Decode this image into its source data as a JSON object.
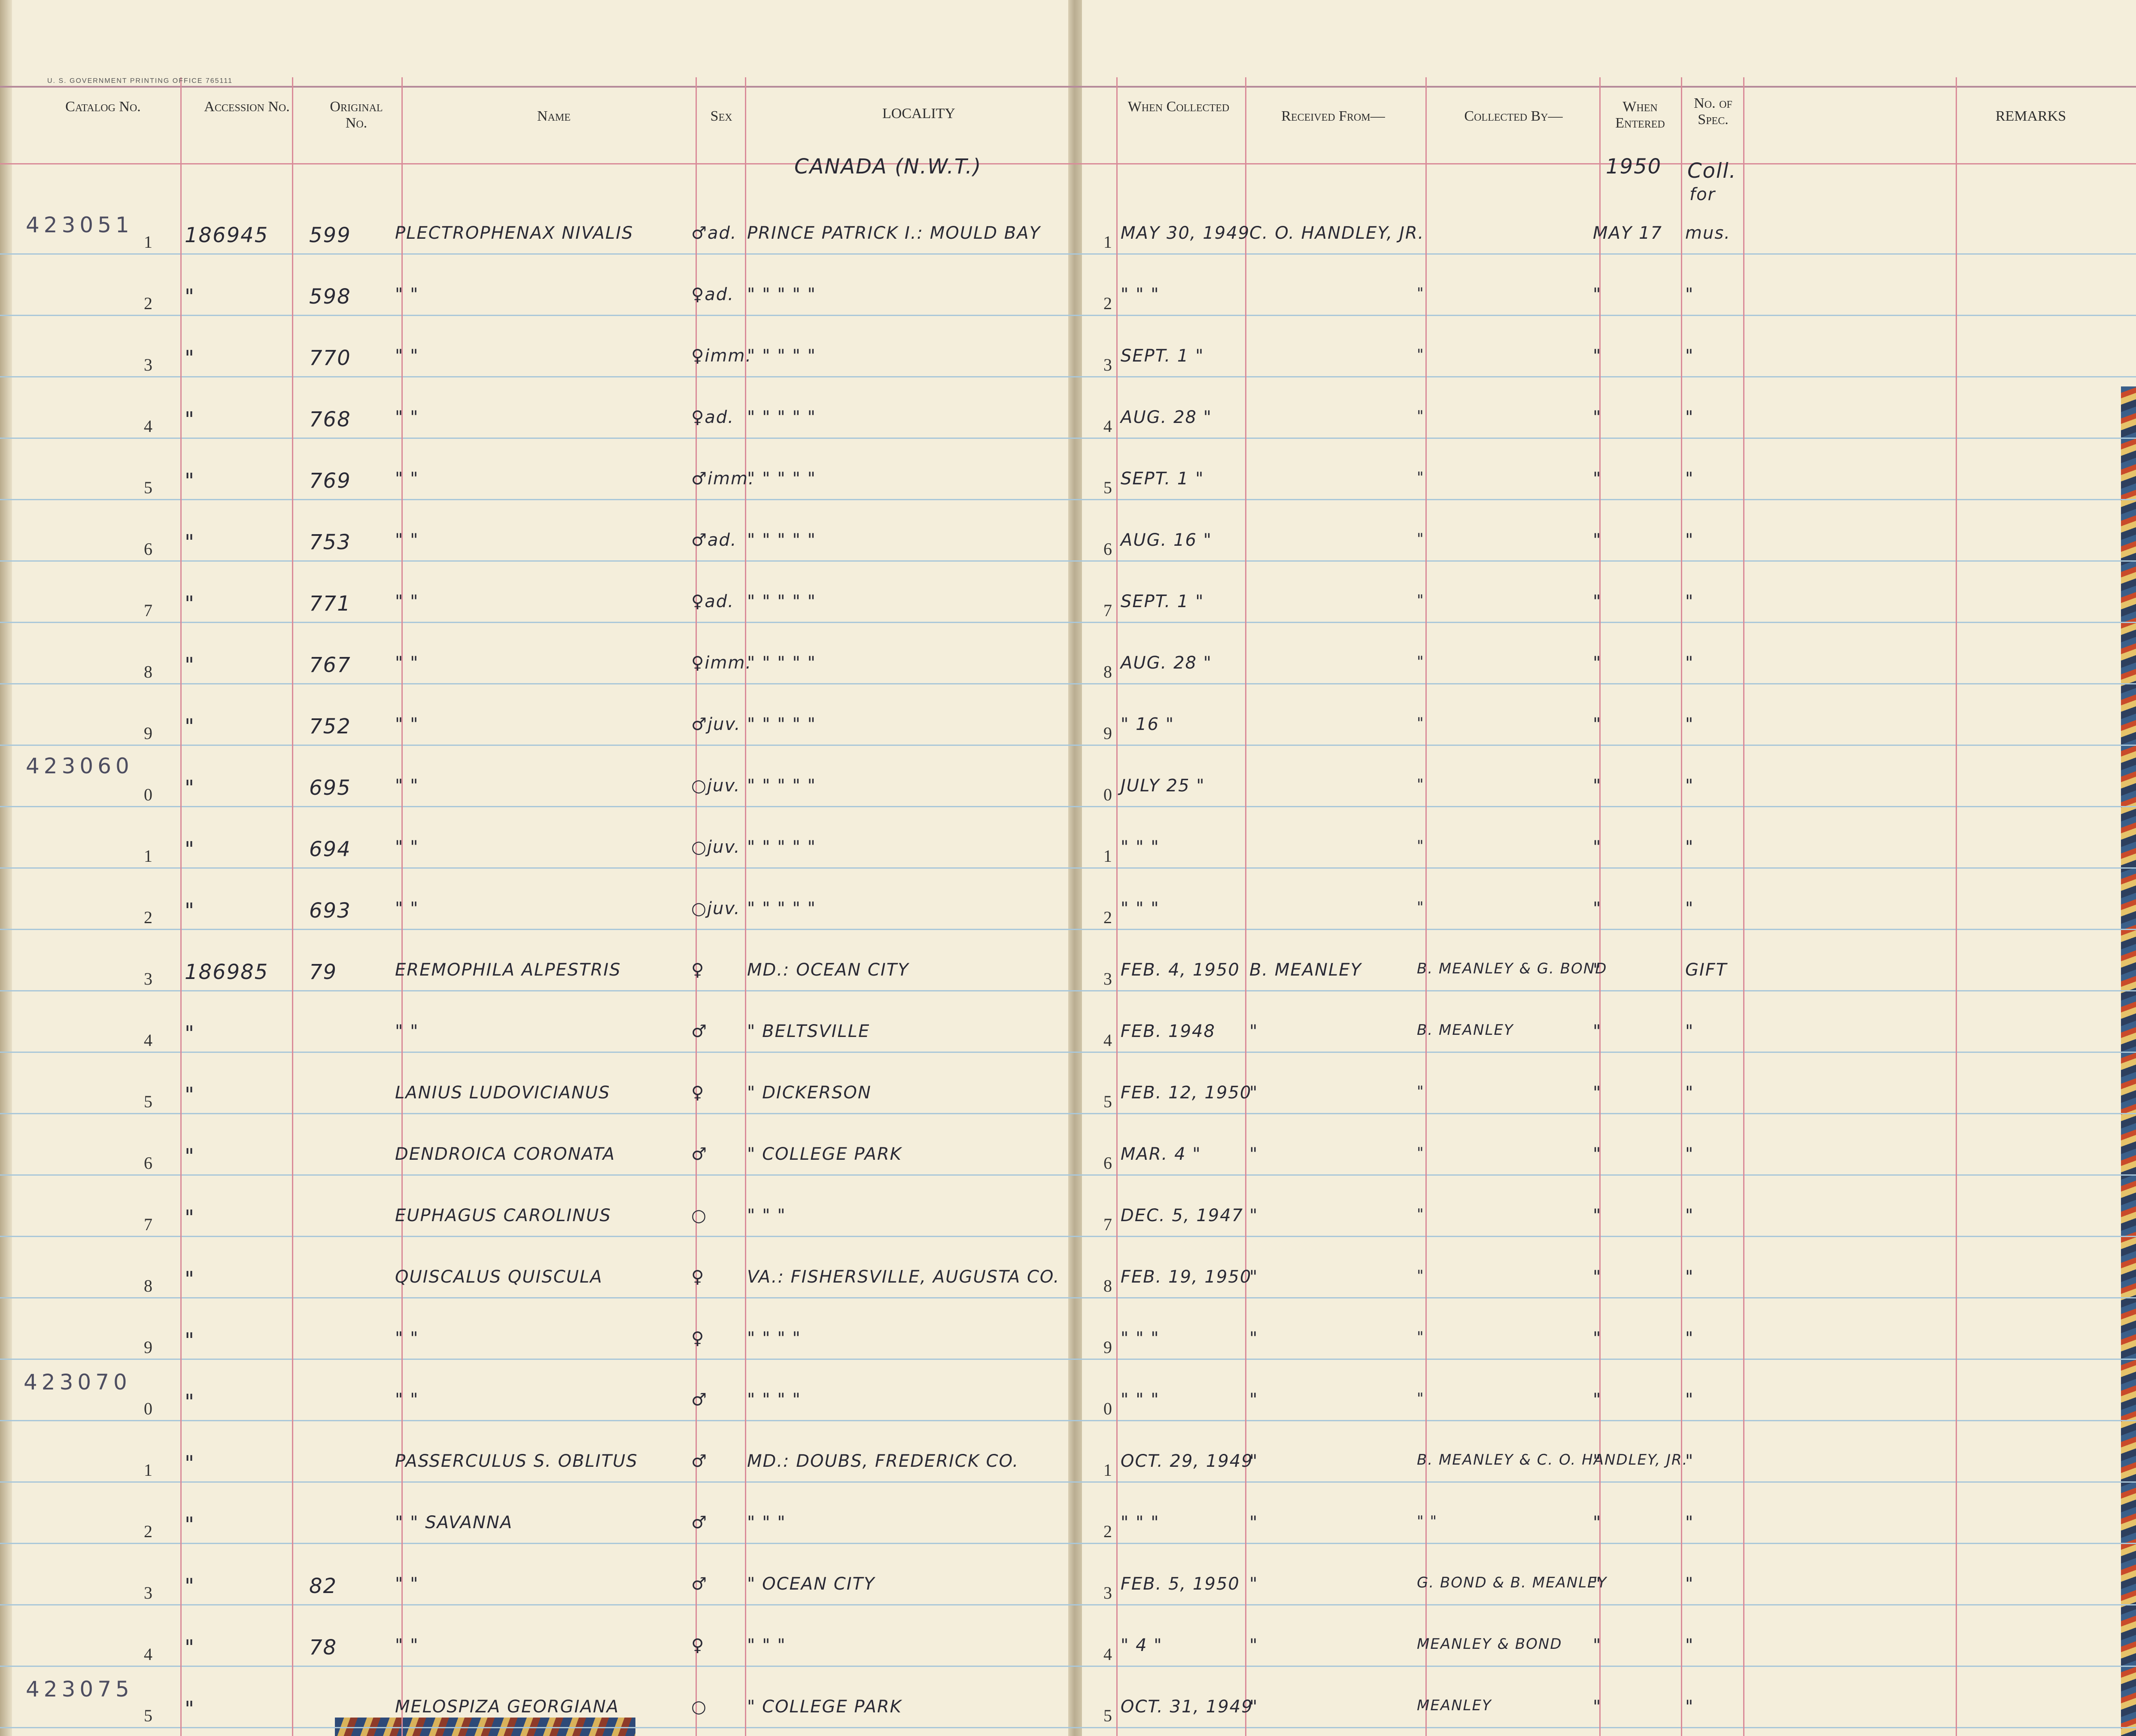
{
  "printer_line": "U. S. GOVERNMENT PRINTING OFFICE    765111",
  "headers": {
    "catalog": "Catalog No.",
    "accession": "Accession No.",
    "original": "Original No.",
    "name": "Name",
    "sex": "Sex",
    "locality": "LOCALITY",
    "when_collected": "When Collected",
    "received_from": "Received From—",
    "collected_by": "Collected By—",
    "when_entered": "When Entered",
    "no_of_spec": "No. of Spec.",
    "remarks": "REMARKS"
  },
  "top_notes": {
    "locality_heading": "CANADA (N.W.T.)",
    "year_entered": "1950",
    "spec_note_1": "Coll.",
    "spec_note_2": "for"
  },
  "catalog_prefixes": [
    "423051",
    "423060",
    "423070",
    "423075"
  ],
  "rows": [
    {
      "n": "1",
      "acc": "186945",
      "orig": "599",
      "name": "PLECTROPHENAX NIVALIS",
      "sex": "♂ad.",
      "loc": "PRINCE PATRICK I.: MOULD BAY",
      "date": "MAY 30, 1949",
      "recv": "C. O. HANDLEY, JR.",
      "coll": "",
      "entered": "MAY 17",
      "spec": "mus."
    },
    {
      "n": "2",
      "acc": "\"",
      "orig": "598",
      "name": "\"        \"",
      "sex": "♀ad.",
      "loc": "\"   \"   \"   \"   \"",
      "date": "\"   \"   \"",
      "recv": "",
      "coll": "\"",
      "entered": "\"",
      "spec": "\""
    },
    {
      "n": "3",
      "acc": "\"",
      "orig": "770",
      "name": "\"        \"",
      "sex": "♀imm.",
      "loc": "\"   \"   \"   \"   \"",
      "date": "SEPT. 1  \"",
      "recv": "",
      "coll": "\"",
      "entered": "\"",
      "spec": "\""
    },
    {
      "n": "4",
      "acc": "\"",
      "orig": "768",
      "name": "\"        \"",
      "sex": "♀ad.",
      "loc": "\"   \"   \"   \"   \"",
      "date": "AUG. 28  \"",
      "recv": "",
      "coll": "\"",
      "entered": "\"",
      "spec": "\""
    },
    {
      "n": "5",
      "acc": "\"",
      "orig": "769",
      "name": "\"        \"",
      "sex": "♂imm.",
      "loc": "\"   \"   \"   \"   \"",
      "date": "SEPT. 1  \"",
      "recv": "",
      "coll": "\"",
      "entered": "\"",
      "spec": "\""
    },
    {
      "n": "6",
      "acc": "\"",
      "orig": "753",
      "name": "\"        \"",
      "sex": "♂ad.",
      "loc": "\"   \"   \"   \"   \"",
      "date": "AUG. 16  \"",
      "recv": "",
      "coll": "\"",
      "entered": "\"",
      "spec": "\""
    },
    {
      "n": "7",
      "acc": "\"",
      "orig": "771",
      "name": "\"        \"",
      "sex": "♀ad.",
      "loc": "\"   \"   \"   \"   \"",
      "date": "SEPT. 1  \"",
      "recv": "",
      "coll": "\"",
      "entered": "\"",
      "spec": "\""
    },
    {
      "n": "8",
      "acc": "\"",
      "orig": "767",
      "name": "\"        \"",
      "sex": "♀imm.",
      "loc": "\"   \"   \"   \"   \"",
      "date": "AUG. 28  \"",
      "recv": "",
      "coll": "\"",
      "entered": "\"",
      "spec": "\""
    },
    {
      "n": "9",
      "acc": "\"",
      "orig": "752",
      "name": "\"        \"",
      "sex": "♂juv.",
      "loc": "\"   \"   \"   \"   \"",
      "date": "\"  16  \"",
      "recv": "",
      "coll": "\"",
      "entered": "\"",
      "spec": "\""
    },
    {
      "n": "0",
      "acc": "\"",
      "orig": "695",
      "name": "\"        \"",
      "sex": "○juv.",
      "loc": "\"   \"   \"   \"   \"",
      "date": "JULY 25  \"",
      "recv": "",
      "coll": "\"",
      "entered": "\"",
      "spec": "\""
    },
    {
      "n": "1",
      "acc": "\"",
      "orig": "694",
      "name": "\"        \"",
      "sex": "○juv.",
      "loc": "\"   \"   \"   \"   \"",
      "date": "\"   \"   \"",
      "recv": "",
      "coll": "\"",
      "entered": "\"",
      "spec": "\""
    },
    {
      "n": "2",
      "acc": "\"",
      "orig": "693",
      "name": "\"        \"",
      "sex": "○juv.",
      "loc": "\"   \"   \"   \"   \"",
      "date": "\"   \"   \"",
      "recv": "",
      "coll": "\"",
      "entered": "\"",
      "spec": "\""
    },
    {
      "n": "3",
      "acc": "186985",
      "orig": "79",
      "name": "EREMOPHILA ALPESTRIS",
      "sex": "♀",
      "loc": "MD.: OCEAN CITY",
      "date": "FEB. 4, 1950",
      "recv": "B. MEANLEY",
      "coll": "B. MEANLEY & G. BOND",
      "entered": "\"",
      "spec": "GIFT"
    },
    {
      "n": "4",
      "acc": "\"",
      "orig": "",
      "name": "\"        \"",
      "sex": "♂",
      "loc": "\"   BELTSVILLE",
      "date": "FEB. 1948",
      "recv": "\"",
      "coll": "B. MEANLEY",
      "entered": "\"",
      "spec": "\""
    },
    {
      "n": "5",
      "acc": "\"",
      "orig": "",
      "name": "LANIUS LUDOVICIANUS",
      "sex": "♀",
      "loc": "\"   DICKERSON",
      "date": "FEB. 12, 1950",
      "recv": "\"",
      "coll": "\"",
      "entered": "\"",
      "spec": "\""
    },
    {
      "n": "6",
      "acc": "\"",
      "orig": "",
      "name": "DENDROICA CORONATA",
      "sex": "♂",
      "loc": "\"   COLLEGE PARK",
      "date": "MAR. 4  \"",
      "recv": "\"",
      "coll": "\"",
      "entered": "\"",
      "spec": "\""
    },
    {
      "n": "7",
      "acc": "\"",
      "orig": "",
      "name": "EUPHAGUS CAROLINUS",
      "sex": "○",
      "loc": "\"    \"    \"",
      "date": "DEC. 5, 1947",
      "recv": "\"",
      "coll": "\"",
      "entered": "\"",
      "spec": "\""
    },
    {
      "n": "8",
      "acc": "\"",
      "orig": "",
      "name": "QUISCALUS QUISCULA",
      "sex": "♀",
      "loc": "VA.: FISHERSVILLE, AUGUSTA CO.",
      "date": "FEB. 19, 1950",
      "recv": "\"",
      "coll": "\"",
      "entered": "\"",
      "spec": "\""
    },
    {
      "n": "9",
      "acc": "\"",
      "orig": "",
      "name": "\"        \"",
      "sex": "♀",
      "loc": "\"    \"    \"    \"",
      "date": "\"   \"   \"",
      "recv": "\"",
      "coll": "\"",
      "entered": "\"",
      "spec": "\""
    },
    {
      "n": "0",
      "acc": "\"",
      "orig": "",
      "name": "\"        \"",
      "sex": "♂",
      "loc": "\"    \"    \"    \"",
      "date": "\"   \"   \"",
      "recv": "\"",
      "coll": "\"",
      "entered": "\"",
      "spec": "\""
    },
    {
      "n": "1",
      "acc": "\"",
      "orig": "",
      "name": "PASSERCULUS S. OBLITUS",
      "sex": "♂",
      "loc": "MD.: DOUBS, FREDERICK CO.",
      "date": "OCT. 29, 1949",
      "recv": "\"",
      "coll": "B. MEANLEY & C. O. HANDLEY, JR.",
      "entered": "\"",
      "spec": "\""
    },
    {
      "n": "2",
      "acc": "\"",
      "orig": "",
      "name": "\"     \"  SAVANNA",
      "sex": "♂",
      "loc": "\"    \"    \"",
      "date": "\"   \"   \"",
      "recv": "\"",
      "coll": "\"    \"",
      "entered": "\"",
      "spec": "\""
    },
    {
      "n": "3",
      "acc": "\"",
      "orig": "82",
      "name": "\"     \"",
      "sex": "♂",
      "loc": "\"   OCEAN CITY",
      "date": "FEB. 5, 1950",
      "recv": "\"",
      "coll": "G. BOND & B. MEANLEY",
      "entered": "\"",
      "spec": "\""
    },
    {
      "n": "4",
      "acc": "\"",
      "orig": "78",
      "name": "\"     \"",
      "sex": "♀",
      "loc": "\"    \"    \"",
      "date": "\" 4 \"",
      "recv": "\"",
      "coll": "MEANLEY & BOND",
      "entered": "\"",
      "spec": "\""
    },
    {
      "n": "5",
      "acc": "\"",
      "orig": "",
      "name": "MELOSPIZA GEORGIANA",
      "sex": "○",
      "loc": "\"   COLLEGE PARK",
      "date": "OCT. 31, 1949",
      "recv": "\"",
      "coll": "MEANLEY",
      "entered": "\"",
      "spec": "\""
    }
  ]
}
